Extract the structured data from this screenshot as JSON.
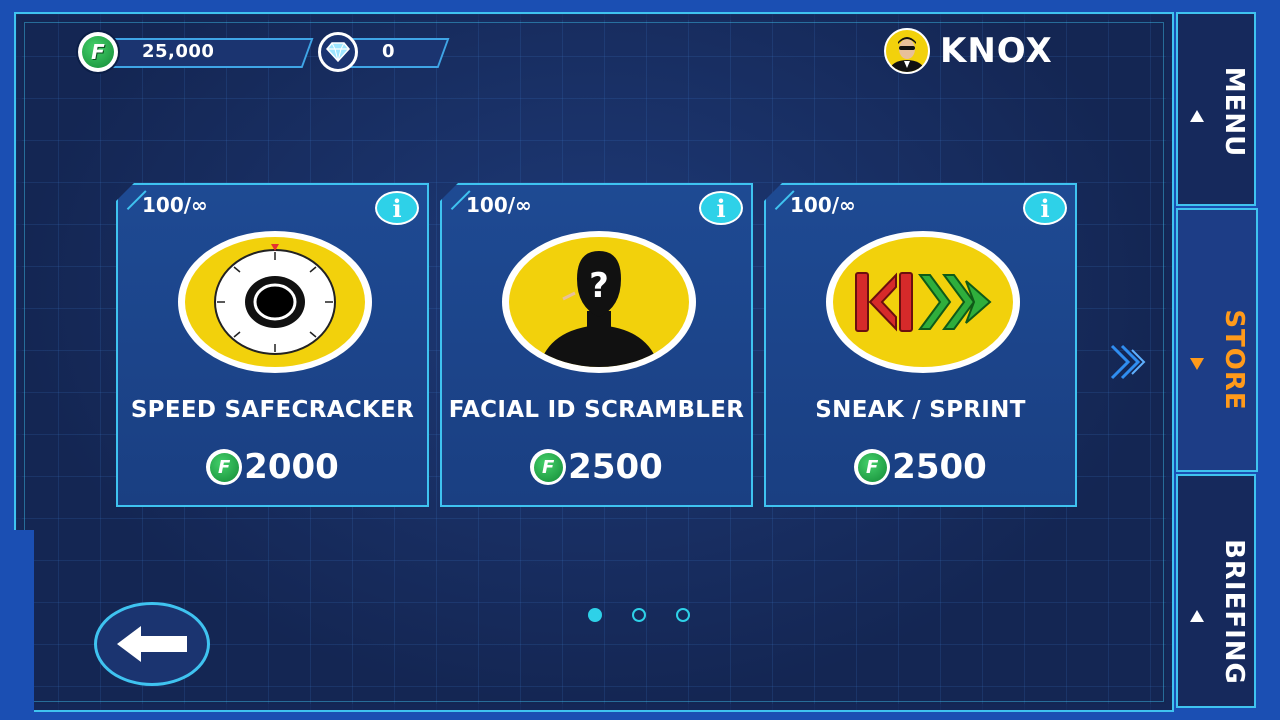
{
  "currency": {
    "coins": "25,000",
    "coin_symbol": "F",
    "gems": "0"
  },
  "player": {
    "name": "KNOX"
  },
  "store_items": [
    {
      "stock": "100/∞",
      "name": "SPEED SAFECRACKER",
      "price": "2000",
      "icon": "safe-dial-icon"
    },
    {
      "stock": "100/∞",
      "name": "FACIAL ID SCRAMBLER",
      "price": "2500",
      "icon": "unknown-person-icon"
    },
    {
      "stock": "100/∞",
      "name": "SNEAK / SPRINT",
      "price": "2500",
      "icon": "sneak-sprint-icon"
    }
  ],
  "info_glyph": "i",
  "nav": {
    "menu": "MENU",
    "store": "STORE",
    "briefing": "BRIEFING",
    "active": "store"
  },
  "pagination": {
    "pages": 3,
    "current": 1
  },
  "colors": {
    "accent": "#3fc3f0",
    "active_tab": "#ff9a1a",
    "coin_green": "#138a36",
    "emblem_yellow": "#f2d10c"
  }
}
